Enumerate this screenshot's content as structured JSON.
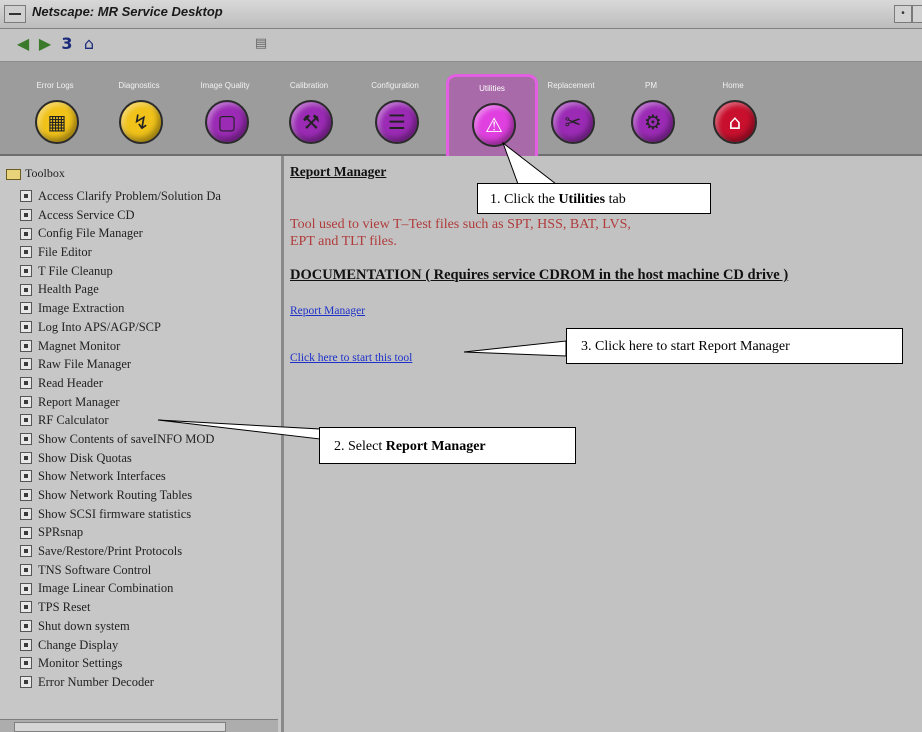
{
  "window": {
    "title": "Netscape: MR Service Desktop"
  },
  "tabs": [
    {
      "label": "Error Logs",
      "color": "#f0c21a",
      "glyph": "▦",
      "active": false
    },
    {
      "label": "Diagnostics",
      "color": "#f0c21a",
      "glyph": "↯",
      "active": false
    },
    {
      "label": "Image Quality",
      "color": "#9b2bb5",
      "glyph": "▢",
      "active": false
    },
    {
      "label": "Calibration",
      "color": "#9b2bb5",
      "glyph": "⚒",
      "active": false
    },
    {
      "label": "Configuration",
      "color": "#9b2bb5",
      "glyph": "☰",
      "active": false
    },
    {
      "label": "Utilities",
      "color": "#e040e0",
      "glyph": "⚠",
      "active": true
    },
    {
      "label": "Replacement",
      "color": "#9b2bb5",
      "glyph": "✂",
      "active": false
    },
    {
      "label": "PM",
      "color": "#9b2bb5",
      "glyph": "⚙",
      "active": false
    },
    {
      "label": "Home",
      "color": "#c8102e",
      "glyph": "⌂",
      "active": false
    }
  ],
  "sidebar": {
    "root_label": "Toolbox",
    "items": [
      "Access Clarify Problem/Solution Da",
      "Access Service CD",
      "Config File Manager",
      "File Editor",
      "T File Cleanup",
      "Health Page",
      "Image Extraction",
      "Log Into APS/AGP/SCP",
      "Magnet Monitor",
      "Raw File Manager",
      "Read Header",
      "Report Manager",
      "RF Calculator",
      "Show Contents of saveINFO MOD",
      "Show Disk Quotas",
      "Show Network Interfaces",
      "Show Network Routing Tables",
      "Show SCSI firmware statistics",
      "SPRsnap",
      "Save/Restore/Print Protocols",
      "TNS Software Control",
      "Image Linear Combination",
      "TPS Reset",
      "Shut down system",
      "Change Display",
      "Monitor Settings",
      "Error Number Decoder"
    ]
  },
  "content": {
    "title": "Report Manager",
    "description_line1": "Tool used to view T–Test files such as SPT, HSS, BAT, LVS,",
    "description_line2": "EPT and TLT files.",
    "doc_heading": "DOCUMENTATION ( Requires service CDROM in the host machine CD drive )",
    "doc_link": "Report Manager",
    "start_link": "Click here to start this tool"
  },
  "callouts": {
    "step1_prefix": "1.  Click the ",
    "step1_bold": "Utilities",
    "step1_suffix": " tab",
    "step2_prefix": "2.  Select ",
    "step2_bold": "Report Manager",
    "step3_text": "3.  Click here to start Report Manager"
  }
}
